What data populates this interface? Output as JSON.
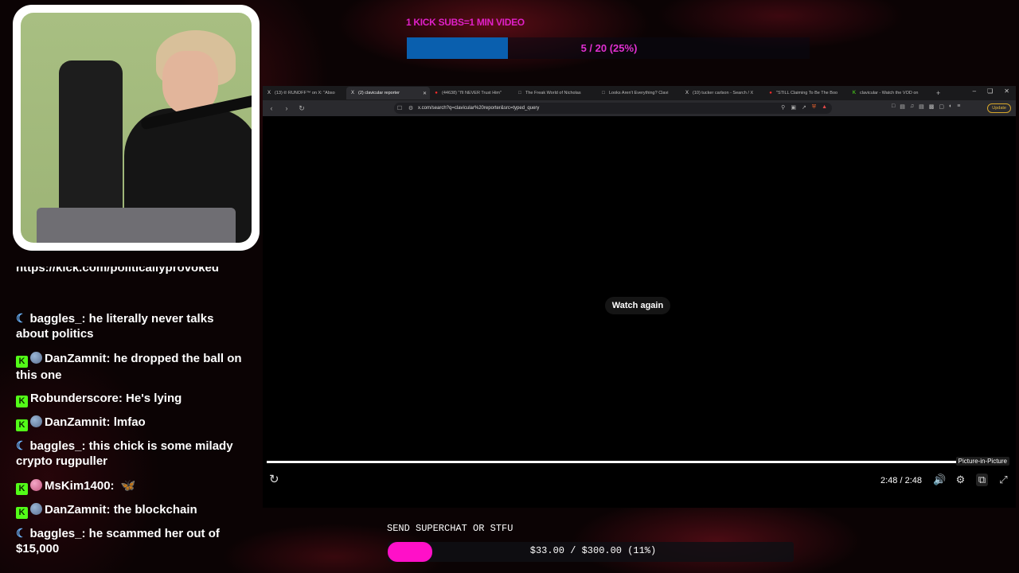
{
  "top_goal": {
    "title": "1 KICK SUBS=1 MIN VIDEO",
    "progress_text": "5 / 20 (25%)",
    "fraction": 0.25
  },
  "browser": {
    "tabs": [
      {
        "icon": "x-logo",
        "label": "(13) ℗ RUNOFF™ on X: \"Abso",
        "active": false
      },
      {
        "icon": "x-logo",
        "label": "(2) clavicular reporter",
        "active": true
      },
      {
        "icon": "youtube-logo",
        "label": "(44638) \"I'll NEVER Trust Him\"",
        "active": false
      },
      {
        "icon": "page-icon",
        "label": "The Freak World of Nicholas",
        "active": false
      },
      {
        "icon": "page-icon",
        "label": "Looks Aren't Everything? Clavi",
        "active": false
      },
      {
        "icon": "x-logo",
        "label": "(10) tucker carlson - Search / X",
        "active": false
      },
      {
        "icon": "youtube-logo",
        "label": "\"STILL Claiming To Be The Boo",
        "active": false
      },
      {
        "icon": "kick-logo",
        "label": "clavicular - Watch the VOD on",
        "active": false
      }
    ],
    "url": "x.com/search?q=clavicular%20reporter&src=typed_query",
    "update_label": "Update"
  },
  "video": {
    "watch_again_label": "Watch again",
    "tooltip": "Picture-in-Picture",
    "time": "2:48 / 2:48",
    "played_fraction": 1.0
  },
  "chat": {
    "cut_line": "https://kick.com/politicallyprovoked",
    "messages": [
      {
        "badges": [
          "moon"
        ],
        "user": "baggles_",
        "text": "he literally never talks about politics"
      },
      {
        "badges": [
          "kick",
          "globe"
        ],
        "user": "DanZamnit",
        "text": "he dropped the ball on this one"
      },
      {
        "badges": [
          "kick"
        ],
        "user": "Robunderscore",
        "text": "He's lying"
      },
      {
        "badges": [
          "kick",
          "globe"
        ],
        "user": "DanZamnit",
        "text": "lmfao"
      },
      {
        "badges": [
          "moon"
        ],
        "user": "baggles_",
        "text": "this chick is some milady crypto rugpuller"
      },
      {
        "badges": [
          "kick",
          "pinkball"
        ],
        "user": "MsKim1400",
        "text": "",
        "emote": "butterfly"
      },
      {
        "badges": [
          "kick",
          "globe"
        ],
        "user": "DanZamnit",
        "text": "the blockchain"
      },
      {
        "badges": [
          "moon"
        ],
        "user": "baggles_",
        "text": "he scammed her out of $15,000"
      }
    ]
  },
  "superchat_goal": {
    "title": "SEND SUPERCHAT OR STFU",
    "progress_text": "$33.00 / $300.00 (11%)",
    "fraction": 0.11
  },
  "colors": {
    "goal_magenta": "#e020c8",
    "goal_fill_blue": "#0a5fae",
    "superchat_fill": "#ff10c8",
    "kick_green": "#53fc18"
  }
}
